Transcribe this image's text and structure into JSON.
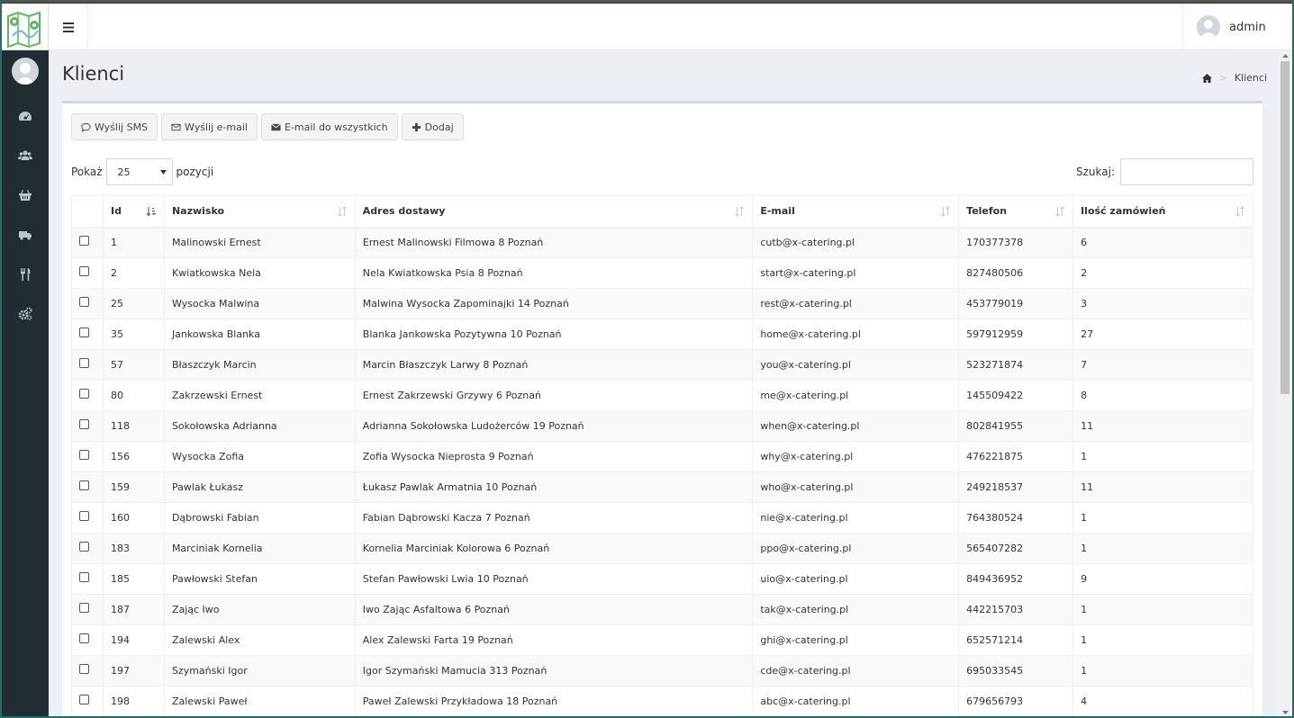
{
  "header": {
    "user_name": "admin"
  },
  "page": {
    "title": "Klienci",
    "breadcrumb_current": "Klienci"
  },
  "toolbar": {
    "sms_label": "Wyślij SMS",
    "email_label": "Wyślij e-mail",
    "email_all_label": "E-mail do wszystkich",
    "add_label": "Dodaj"
  },
  "controls": {
    "show_prefix": "Pokaż",
    "page_size": "25",
    "show_suffix": "pozycji",
    "search_label": "Szukaj:",
    "search_value": ""
  },
  "table": {
    "columns": {
      "id": "Id",
      "surname": "Nazwisko",
      "address": "Adres dostawy",
      "email": "E-mail",
      "phone": "Telefon",
      "orders": "Ilość zamówień"
    },
    "rows": [
      {
        "id": "1",
        "name": "Malinowski Ernest",
        "address": "Ernest Malinowski Filmowa 8 Poznań",
        "email": "cutb@x-catering.pl",
        "phone": "170377378",
        "orders": "6"
      },
      {
        "id": "2",
        "name": "Kwiatkowska Nela",
        "address": "Nela Kwiatkowska Psia 8 Poznań",
        "email": "start@x-catering.pl",
        "phone": "827480506",
        "orders": "2"
      },
      {
        "id": "25",
        "name": "Wysocka Malwina",
        "address": "Malwina Wysocka Zapominajki 14 Poznań",
        "email": "rest@x-catering.pl",
        "phone": "453779019",
        "orders": "3"
      },
      {
        "id": "35",
        "name": "Jankowska Blanka",
        "address": "Blanka Jankowska Pozytywna 10 Poznań",
        "email": "home@x-catering.pl",
        "phone": "597912959",
        "orders": "27"
      },
      {
        "id": "57",
        "name": "Błaszczyk Marcin",
        "address": "Marcin Błaszczyk Larwy 8 Poznań",
        "email": "you@x-catering.pl",
        "phone": "523271874",
        "orders": "7"
      },
      {
        "id": "80",
        "name": "Zakrzewski Ernest",
        "address": "Ernest Zakrzewski Grzywy 6 Poznań",
        "email": "me@x-catering.pl",
        "phone": "145509422",
        "orders": "8"
      },
      {
        "id": "118",
        "name": "Sokołowska Adrianna",
        "address": "Adrianna Sokołowska Ludożerców 19 Poznań",
        "email": "when@x-catering.pl",
        "phone": "802841955",
        "orders": "11"
      },
      {
        "id": "156",
        "name": "Wysocka Zofia",
        "address": "Zofia Wysocka Nieprosta 9 Poznań",
        "email": "why@x-catering.pl",
        "phone": "476221875",
        "orders": "1"
      },
      {
        "id": "159",
        "name": "Pawlak Łukasz",
        "address": "Łukasz Pawlak Armatnia 10 Poznań",
        "email": "who@x-catering.pl",
        "phone": "249218537",
        "orders": "11"
      },
      {
        "id": "160",
        "name": "Dąbrowski Fabian",
        "address": "Fabian Dąbrowski Kacza 7 Poznań",
        "email": "nie@x-catering.pl",
        "phone": "764380524",
        "orders": "1"
      },
      {
        "id": "183",
        "name": "Marciniak Kornelia",
        "address": "Kornelia Marciniak Kolorowa 6 Poznań",
        "email": "ppo@x-catering.pl",
        "phone": "565407282",
        "orders": "1"
      },
      {
        "id": "185",
        "name": "Pawłowski Stefan",
        "address": "Stefan Pawłowski Lwia 10 Poznań",
        "email": "uio@x-catering.pl",
        "phone": "849436952",
        "orders": "9"
      },
      {
        "id": "187",
        "name": "Zając Iwo",
        "address": "Iwo Zając Asfaltowa 6 Poznań",
        "email": "tak@x-catering.pl",
        "phone": "442215703",
        "orders": "1"
      },
      {
        "id": "194",
        "name": "Zalewski Alex",
        "address": "Alex Zalewski Farta 19 Poznań",
        "email": "ghi@x-catering.pl",
        "phone": "652571214",
        "orders": "1"
      },
      {
        "id": "197",
        "name": "Szymański Igor",
        "address": "Igor Szymański Mamucia 313 Poznań",
        "email": "cde@x-catering.pl",
        "phone": "695033545",
        "orders": "1"
      },
      {
        "id": "198",
        "name": "Zalewski Paweł",
        "address": "Paweł Zalewski Przykładowa 18 Poznań",
        "email": "abc@x-catering.pl",
        "phone": "679656793",
        "orders": "4"
      }
    ]
  },
  "icons": {
    "sidebar": [
      "dashboard-icon",
      "users-icon",
      "basket-icon",
      "truck-icon",
      "cutlery-icon",
      "cogs-icon"
    ],
    "brand_colors": {
      "sidebar": "#222d32",
      "accent_bar": "#8b2a1e",
      "logo_green": "#5cb85c"
    }
  }
}
